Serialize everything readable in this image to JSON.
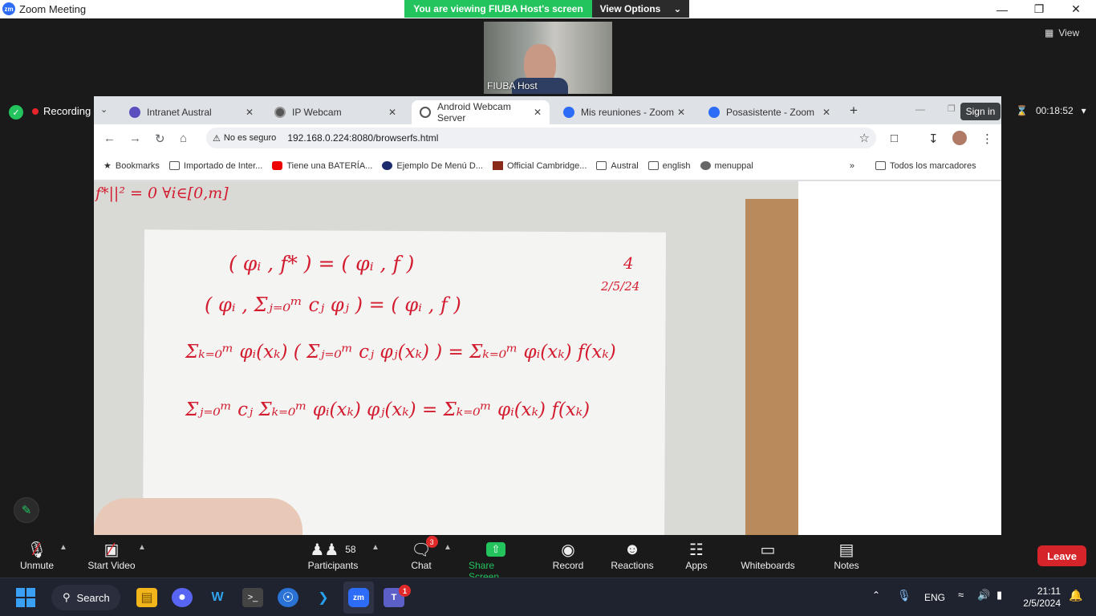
{
  "window": {
    "title": "Zoom Meeting",
    "minimize_icon": "minimize-icon",
    "maximize_icon": "restore-icon",
    "close_icon": "close-icon"
  },
  "share_banner": {
    "text": "You are viewing FIUBA Host's screen",
    "view_options": "View Options"
  },
  "participant": {
    "name": "FIUBA Host"
  },
  "view_button": {
    "label": "View"
  },
  "recording": {
    "label": "Recording"
  },
  "timer": {
    "value": "00:18:52"
  },
  "browser": {
    "tabs": [
      {
        "label": "Intranet Austral",
        "active": false
      },
      {
        "label": "IP Webcam",
        "active": false
      },
      {
        "label": "Android Webcam Server",
        "active": true
      },
      {
        "label": "Mis reuniones - Zoom",
        "active": false
      },
      {
        "label": "Posasistente - Zoom",
        "active": false
      }
    ],
    "new_tab": "+",
    "sign_in": "Sign in",
    "security": "No es seguro",
    "url": "192.168.0.224:8080/browserfs.html",
    "bookmarks": [
      "Bookmarks",
      "Importado de Inter...",
      "Tiene una BATERÍA...",
      "Ejemplo De Menú D...",
      "Official Cambridge...",
      "Austral",
      "english",
      "menuppal"
    ],
    "all_bookmarks": "Todos los marcadores"
  },
  "whiteboard": {
    "line0": "f*||² = 0   ∀i∈[0,m]",
    "line1": "( φᵢ , f* ) = ( φᵢ , f )",
    "line2": "( φᵢ , Σⱼ₌₀ᵐ cⱼ φⱼ ) = ( φᵢ , f )",
    "line3": "Σₖ₌₀ᵐ φᵢ(xₖ) ( Σⱼ₌₀ᵐ cⱼ φⱼ(xₖ) ) = Σₖ₌₀ᵐ φᵢ(xₖ) f(xₖ)",
    "line4": "Σⱼ₌₀ᵐ cⱼ  Σₖ₌₀ᵐ φᵢ(xₖ) φⱼ(xₖ) = Σₖ₌₀ᵐ φᵢ(xₖ) f(xₖ)",
    "page": "4",
    "date": "2/5/24"
  },
  "toolbar": {
    "unmute": "Unmute",
    "start_video": "Start Video",
    "participants": "Participants",
    "participants_count": "58",
    "chat": "Chat",
    "chat_badge": "3",
    "share_screen": "Share Screen",
    "record": "Record",
    "reactions": "Reactions",
    "apps": "Apps",
    "whiteboards": "Whiteboards",
    "notes": "Notes",
    "leave": "Leave"
  },
  "taskbar": {
    "search": "Search",
    "lang": "ENG",
    "time": "21:11",
    "date": "2/5/2024",
    "teams_badge": "1"
  },
  "colors": {
    "zoom_green": "#23c45e",
    "leave_red": "#d5252a",
    "ink_red": "#d31c2f",
    "zoom_blue": "#2d6cf6"
  }
}
